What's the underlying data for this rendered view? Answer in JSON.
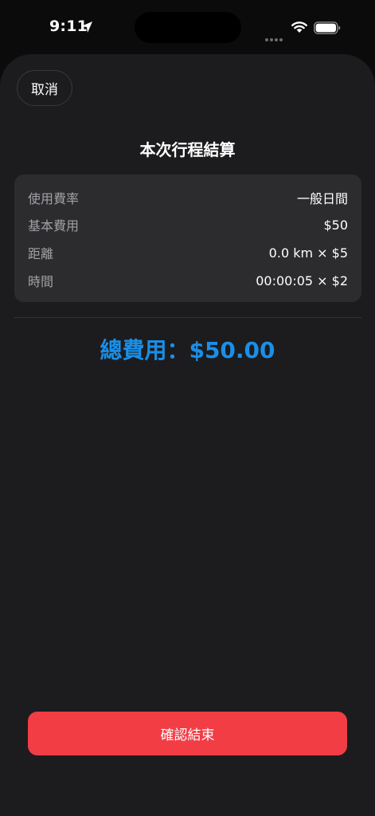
{
  "status_bar": {
    "time": "9:11"
  },
  "header": {
    "cancel_label": "取消",
    "title": "本次行程結算"
  },
  "summary": {
    "rows": [
      {
        "label": "使用費率",
        "value": "一般日間"
      },
      {
        "label": "基本費用",
        "value": "$50"
      },
      {
        "label": "距離",
        "value": "0.0 km × $5"
      },
      {
        "label": "時間",
        "value": "00:00:05 × $2"
      }
    ]
  },
  "total": {
    "text": "總費用：$50.00"
  },
  "footer": {
    "confirm_label": "確認結束"
  },
  "colors": {
    "accent_total": "#1a8fe8",
    "confirm_button": "#f23d45",
    "sheet_background": "#1c1c1e",
    "card_background": "#2c2c2e"
  },
  "icons": [
    "location-arrow-icon",
    "cellular-signal-icon",
    "wifi-icon",
    "battery-icon"
  ]
}
